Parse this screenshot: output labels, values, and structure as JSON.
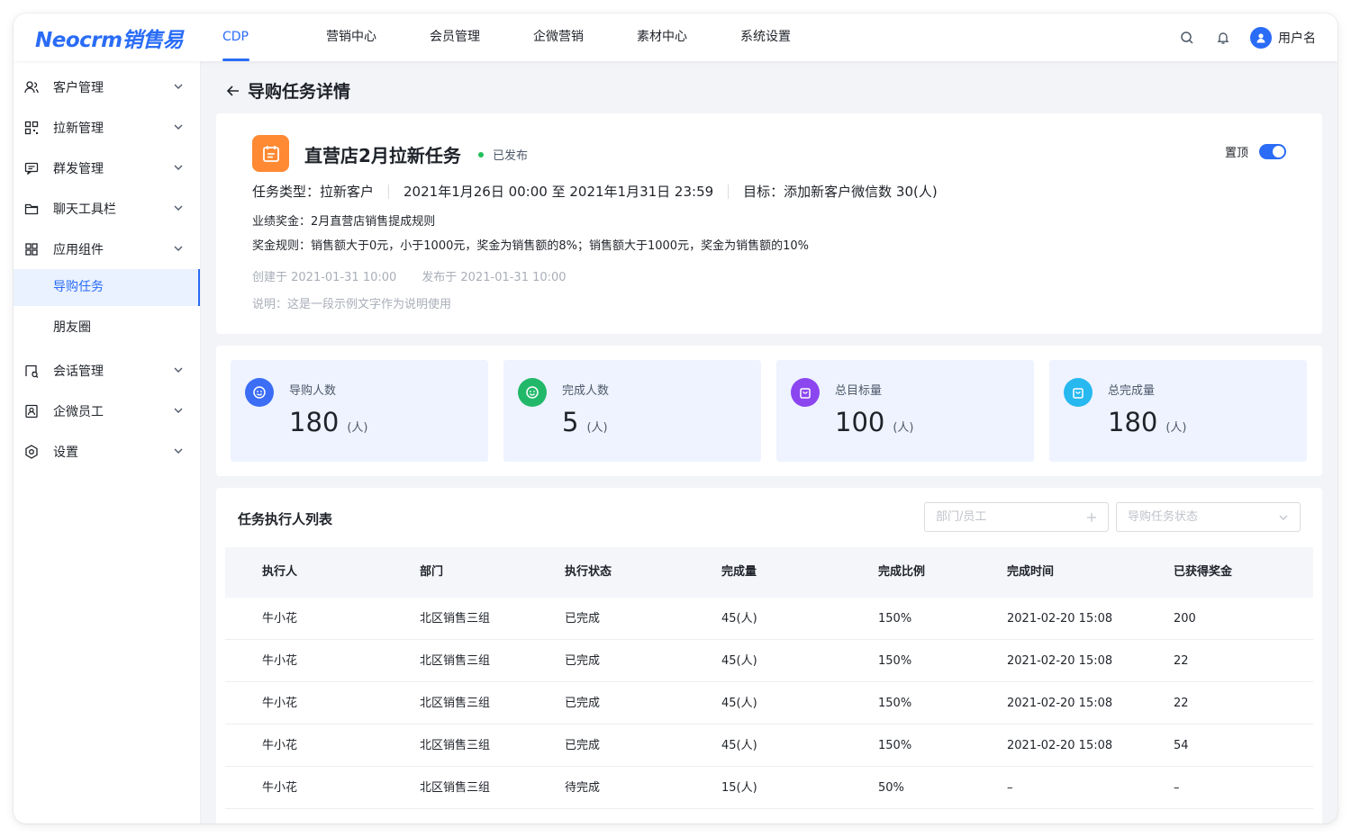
{
  "app": {
    "logo": "Neocrm销售易"
  },
  "nav": {
    "items": [
      "CDP",
      "营销中心",
      "会员管理",
      "企微营销",
      "素材中心",
      "系统设置"
    ],
    "active": "CDP"
  },
  "header": {
    "username": "用户名"
  },
  "sidebar": {
    "items": [
      {
        "label": "客户管理",
        "icon": "users-icon"
      },
      {
        "label": "拉新管理",
        "icon": "qrcode-icon"
      },
      {
        "label": "群发管理",
        "icon": "message-icon"
      },
      {
        "label": "聊天工具栏",
        "icon": "folder-icon"
      },
      {
        "label": "应用组件",
        "icon": "grid-icon"
      }
    ],
    "sub_items": [
      {
        "label": "导购任务",
        "active": true
      },
      {
        "label": "朋友圈",
        "active": false
      }
    ],
    "items_after": [
      {
        "label": "会话管理",
        "icon": "chat-icon"
      },
      {
        "label": "企微员工",
        "icon": "id-card-icon"
      },
      {
        "label": "设置",
        "icon": "settings-icon"
      }
    ]
  },
  "page": {
    "title": "导购任务详情",
    "back_icon": "arrow-left-icon"
  },
  "task": {
    "title": "直营店2月拉新任务",
    "status": "已发布",
    "pin_label": "置顶",
    "pinned": true,
    "type": "任务类型：拉新客户",
    "period": "2021年1月26日 00:00 至 2021年1月31日 23:59",
    "goal": "目标：添加新客户微信数 30(人)",
    "bonus": "业绩奖金：2月直营店销售提成规则",
    "rule": "奖金规则：销售额大于0元，小于1000元，奖金为销售额的8%；销售额大于1000元，奖金为销售额的10%",
    "created": "创建于 2021-01-31 10:00",
    "published": "发布于 2021-01-31 10:00",
    "note": "说明：这是一段示例文字作为说明使用"
  },
  "stats": [
    {
      "label": "导购人数",
      "value": "180",
      "unit": "(人)",
      "color": "#3b6df5",
      "icon": "smile-icon"
    },
    {
      "label": "完成人数",
      "value": "5",
      "unit": "(人)",
      "color": "#22b86a",
      "icon": "smile-icon"
    },
    {
      "label": "总目标量",
      "value": "100",
      "unit": "(人)",
      "color": "#8b46f0",
      "icon": "bag-icon"
    },
    {
      "label": "总完成量",
      "value": "180",
      "unit": "(人)",
      "color": "#27b8f0",
      "icon": "bag-icon"
    }
  ],
  "table": {
    "title": "任务执行人列表",
    "filter_dept_placeholder": "部门/员工",
    "filter_status_placeholder": "导购任务状态",
    "columns": [
      "执行人",
      "部门",
      "执行状态",
      "完成量",
      "完成比例",
      "完成时间",
      "已获得奖金"
    ],
    "rows": [
      [
        "牛小花",
        "北区销售三组",
        "已完成",
        "45(人)",
        "150%",
        "2021-02-20 15:08",
        "200"
      ],
      [
        "牛小花",
        "北区销售三组",
        "已完成",
        "45(人)",
        "150%",
        "2021-02-20 15:08",
        "22"
      ],
      [
        "牛小花",
        "北区销售三组",
        "已完成",
        "45(人)",
        "150%",
        "2021-02-20 15:08",
        "22"
      ],
      [
        "牛小花",
        "北区销售三组",
        "已完成",
        "45(人)",
        "150%",
        "2021-02-20 15:08",
        "54"
      ],
      [
        "牛小花",
        "北区销售三组",
        "待完成",
        "15(人)",
        "50%",
        "–",
        "–"
      ]
    ]
  }
}
